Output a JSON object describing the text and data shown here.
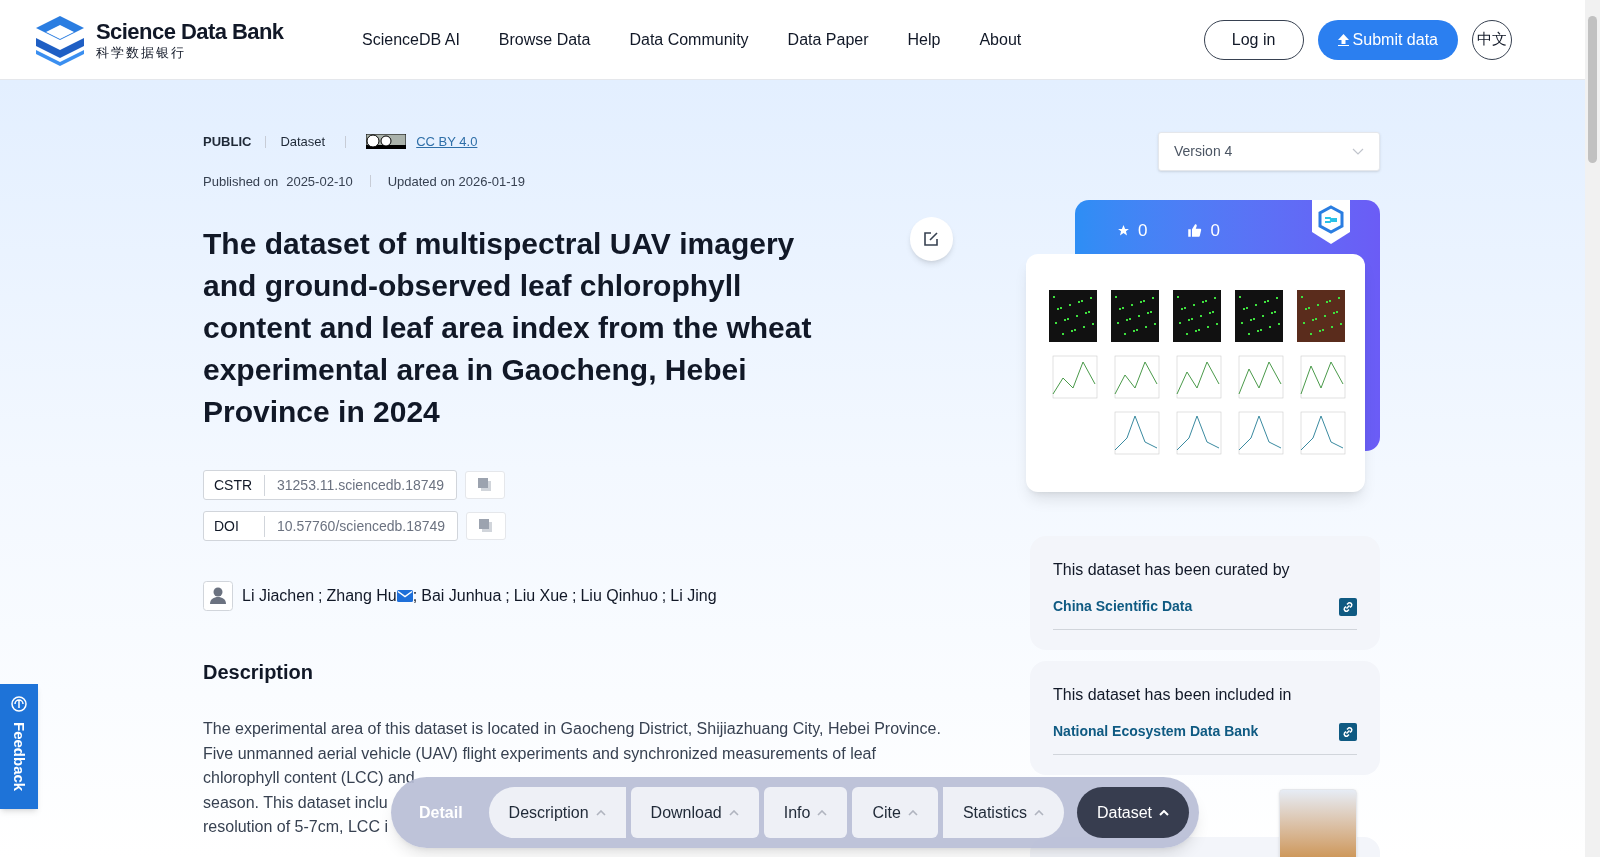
{
  "header": {
    "logo_title": "Science Data Bank",
    "logo_subtitle": "科学数据银行",
    "nav": [
      {
        "label": "ScienceDB AI"
      },
      {
        "label": "Browse Data"
      },
      {
        "label": "Data Community"
      },
      {
        "label": "Data Paper"
      },
      {
        "label": "Help"
      },
      {
        "label": "About"
      }
    ],
    "login": "Log in",
    "submit": "Submit data",
    "language": "中文"
  },
  "meta": {
    "access": "PUBLIC",
    "type": "Dataset",
    "license": "CC BY 4.0",
    "published_label": "Published on",
    "published": "2025-02-10",
    "updated": "Updated on 2026-01-19"
  },
  "title": "The dataset of multispectral UAV imagery and ground-observed leaf chlorophyll content and leaf area index from the wheat experimental area in Gaocheng, Hebei Province in 2024",
  "identifiers": [
    {
      "label": "CSTR",
      "value": "31253.11.sciencedb.18749"
    },
    {
      "label": "DOI",
      "value": "10.57760/sciencedb.18749"
    }
  ],
  "authors": {
    "separator": ";",
    "people": [
      {
        "name": "Li Jiachen",
        "email": false
      },
      {
        "name": "Zhang Hu",
        "email": true
      },
      {
        "name": "Bai Junhua",
        "email": false
      },
      {
        "name": "Liu Xue",
        "email": false
      },
      {
        "name": "Liu Qinhuo",
        "email": false
      },
      {
        "name": "Li Jing",
        "email": false
      }
    ]
  },
  "description": {
    "heading": "Description",
    "lines": [
      "The experimental area of this dataset is located in Gaocheng District, Shijiazhuang City, Hebei Province.",
      "Five unmanned aerial vehicle (UAV) flight experiments and synchronized measurements of leaf",
      "chlorophyll content (LCC) and",
      "season. This dataset inclu",
      "resolution of 5-7cm, LCC i"
    ]
  },
  "version_select": {
    "value": "Version 4"
  },
  "stats": {
    "favorites": "0",
    "likes": "0"
  },
  "curation": [
    {
      "text": "This dataset has been curated by",
      "link": "China Scientific Data"
    },
    {
      "text": "This dataset has been included in",
      "link": "National Ecosystem Data Bank"
    }
  ],
  "detail_nav": {
    "label": "Detail",
    "items": [
      {
        "label": "Description",
        "selected": false
      },
      {
        "label": "Download",
        "selected": false
      },
      {
        "label": "Info",
        "selected": false
      },
      {
        "label": "Cite",
        "selected": false
      },
      {
        "label": "Statistics",
        "selected": false
      },
      {
        "label": "Dataset",
        "selected": true
      }
    ]
  },
  "feedback": "Feedback"
}
